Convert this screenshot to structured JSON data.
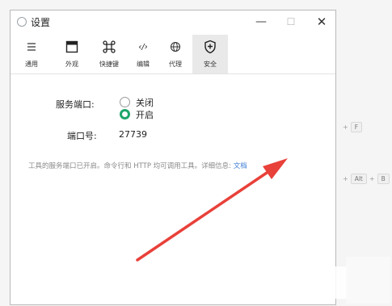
{
  "window": {
    "title": "设置"
  },
  "tabs": [
    {
      "label": "通用",
      "icon": "list-icon"
    },
    {
      "label": "外观",
      "icon": "window-icon"
    },
    {
      "label": "快捷键",
      "icon": "command-icon"
    },
    {
      "label": "编辑",
      "icon": "code-icon"
    },
    {
      "label": "代理",
      "icon": "globe-icon"
    },
    {
      "label": "安全",
      "icon": "shield-plus-icon",
      "active": true
    }
  ],
  "security": {
    "port_service_label": "服务端口:",
    "options": [
      {
        "label": "关闭",
        "checked": false
      },
      {
        "label": "开启",
        "checked": true
      }
    ],
    "port_label": "端口号:",
    "port_value": "27739",
    "description": "工具的服务端口已开启。命令行和 HTTP 均可调用工具。详细信息: ",
    "doc_link": "文档"
  },
  "shortcuts": [
    {
      "key": "F"
    },
    {
      "key1": "Alt",
      "key2": "B"
    }
  ],
  "colors": {
    "accent": "#1fa56a",
    "link": "#3f7fd6",
    "arrow": "#e8413a"
  }
}
